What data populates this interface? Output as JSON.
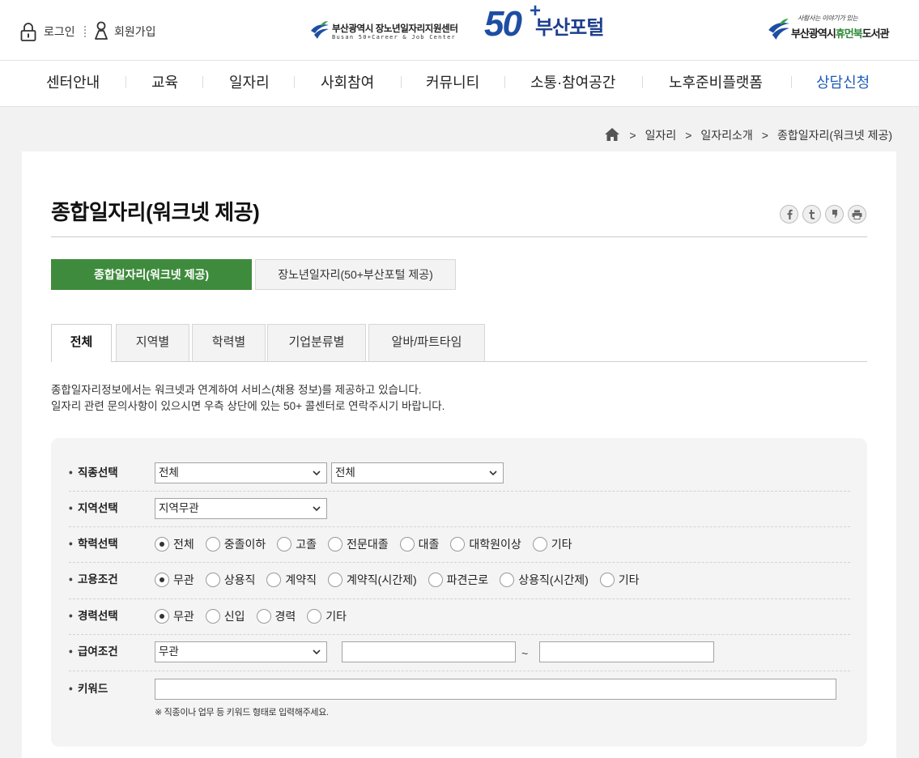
{
  "header": {
    "login_label": "로그인",
    "signup_label": "회원가입",
    "icons": {
      "login": "lock-icon",
      "signup": "user-icon"
    },
    "logo": {
      "org_name": "부산광역시 장노년일자리지원센터",
      "org_name_en": "Busan 50+Career & Job Center",
      "brand_number": "50",
      "brand_plus": "+",
      "brand_name": "부산포털"
    },
    "partner_logo": {
      "tagline": "사람사는 이야기가 있는",
      "name_city": "부산광역시",
      "name_highlight": "휴먼북",
      "name_suffix": "도서관"
    }
  },
  "nav": [
    {
      "label": "센터안내",
      "highlighted": false
    },
    {
      "label": "교육",
      "highlighted": false
    },
    {
      "label": "일자리",
      "highlighted": false
    },
    {
      "label": "사회참여",
      "highlighted": false
    },
    {
      "label": "커뮤니티",
      "highlighted": false
    },
    {
      "label": "소통·참여공간",
      "highlighted": false
    },
    {
      "label": "노후준비플랫폼",
      "highlighted": false
    },
    {
      "label": "상담신청",
      "highlighted": true
    }
  ],
  "breadcrumb": {
    "home_icon": "home-icon",
    "separator": ">",
    "items": [
      "일자리",
      "일자리소개",
      "종합일자리(워크넷 제공)"
    ]
  },
  "page": {
    "title": "종합일자리(워크넷 제공)",
    "share_icons": [
      "facebook-icon",
      "twitter-icon",
      "blog-icon",
      "print-icon"
    ]
  },
  "source_buttons": [
    {
      "label": "종합일자리(워크넷 제공)",
      "active": true
    },
    {
      "label": "장노년일자리(50+부산포털 제공)",
      "active": false
    }
  ],
  "tabs": [
    {
      "label": "전체",
      "active": true
    },
    {
      "label": "지역별",
      "active": false
    },
    {
      "label": "학력별",
      "active": false
    },
    {
      "label": "기업분류별",
      "active": false
    },
    {
      "label": "알바/파트타임",
      "active": false
    }
  ],
  "description": [
    "종합일자리정보에서는 워크넷과 연계하여 서비스(채용 정보)를 제공하고 있습니다.",
    "일자리 관련 문의사항이 있으시면 우측 상단에 있는 50+ 콜센터로 연락주시기 바랍니다."
  ],
  "search_form": {
    "job_type": {
      "label": "직종선택",
      "category": "전체",
      "subcategory": "전체"
    },
    "region": {
      "label": "지역선택",
      "value": "지역무관"
    },
    "education": {
      "label": "학력선택",
      "options": [
        {
          "label": "전체",
          "checked": true
        },
        {
          "label": "중졸이하",
          "checked": false
        },
        {
          "label": "고졸",
          "checked": false
        },
        {
          "label": "전문대졸",
          "checked": false
        },
        {
          "label": "대졸",
          "checked": false
        },
        {
          "label": "대학원이상",
          "checked": false
        },
        {
          "label": "기타",
          "checked": false
        }
      ]
    },
    "employment": {
      "label": "고용조건",
      "options": [
        {
          "label": "무관",
          "checked": true
        },
        {
          "label": "상용직",
          "checked": false
        },
        {
          "label": "계약직",
          "checked": false
        },
        {
          "label": "계약직(시간제)",
          "checked": false
        },
        {
          "label": "파견근로",
          "checked": false
        },
        {
          "label": "상용직(시간제)",
          "checked": false
        },
        {
          "label": "기타",
          "checked": false
        }
      ]
    },
    "career": {
      "label": "경력선택",
      "options": [
        {
          "label": "무관",
          "checked": true
        },
        {
          "label": "신입",
          "checked": false
        },
        {
          "label": "경력",
          "checked": false
        },
        {
          "label": "기타",
          "checked": false
        }
      ]
    },
    "salary": {
      "label": "급여조건",
      "type": "무관",
      "min": "",
      "max": "",
      "range_separator": "~"
    },
    "keyword": {
      "label": "키워드",
      "value": "",
      "hint": "※ 직종이나 업무 등 키워드 형태로 입력해주세요."
    }
  },
  "colors": {
    "brand_blue": "#1e4ea3",
    "accent_green": "#3f8b3d",
    "nav_highlight": "#1e5bb8",
    "page_bg": "#f2f2f2",
    "form_bg": "#f4f4f4"
  }
}
